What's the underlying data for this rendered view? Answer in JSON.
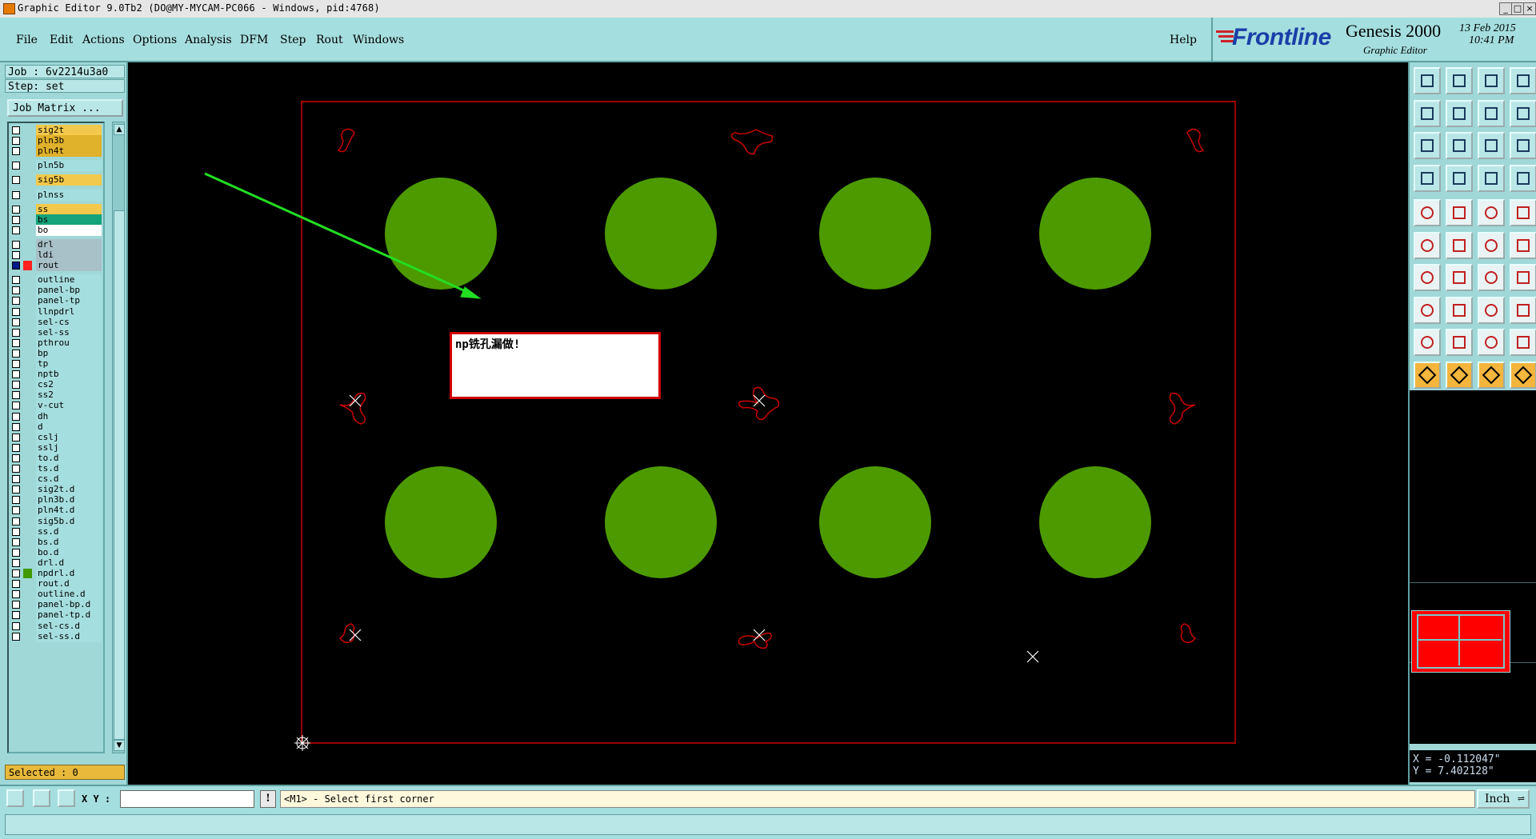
{
  "titlebar": {
    "title": "Graphic Editor 9.0Tb2 (DO@MY-MYCAM-PC066 - Windows, pid:4768)",
    "min_icon": "minimize-icon",
    "max_icon": "maximize-icon",
    "close_icon": "close-icon"
  },
  "menu": {
    "file": "File",
    "edit": "Edit",
    "actions": "Actions",
    "options": "Options",
    "analysis": "Analysis",
    "dfm": "DFM",
    "step": "Step",
    "rout": "Rout",
    "windows": "Windows",
    "help": "Help"
  },
  "brand": {
    "logo": "Frontline",
    "product": "Genesis 2000",
    "subtitle": "Graphic Editor",
    "date": "13 Feb 2015",
    "time": "10:41 PM"
  },
  "left": {
    "job": "Job : 6v2214u3a0",
    "step": "Step: set",
    "job_matrix": "Job Matrix ...",
    "selected": "Selected : 0",
    "layers": [
      {
        "name": "sig2t",
        "color": "#f2c94c"
      },
      {
        "name": "pln3b",
        "color": "#e0b12a"
      },
      {
        "name": "pln4t",
        "color": "#e0b12a"
      },
      {
        "name": "pln5b",
        "color": "#a5dede"
      },
      {
        "name": "sig5b",
        "color": "#f2c94c"
      },
      {
        "name": "plnss",
        "color": "#a5dede"
      },
      {
        "name": "ss",
        "color": "#f2c94c"
      },
      {
        "name": "bs",
        "color": "#14a37a"
      },
      {
        "name": "bo",
        "color": "#ffffff"
      },
      {
        "name": "drl",
        "color": "#a8c0c8"
      },
      {
        "name": "ldi",
        "color": "#a8c0c8"
      },
      {
        "name": "rout",
        "color": "#a8c0c8"
      },
      {
        "name": "outline",
        "color": "#a5dede"
      },
      {
        "name": "panel-bp",
        "color": "#a5dede"
      },
      {
        "name": "panel-tp",
        "color": "#a5dede"
      },
      {
        "name": "llnpdrl",
        "color": "#a5dede"
      },
      {
        "name": "sel-cs",
        "color": "#a5dede"
      },
      {
        "name": "sel-ss",
        "color": "#a5dede"
      },
      {
        "name": "pthrou",
        "color": "#a5dede"
      },
      {
        "name": "bp",
        "color": "#a5dede"
      },
      {
        "name": "tp",
        "color": "#a5dede"
      },
      {
        "name": "nptb",
        "color": "#a5dede"
      },
      {
        "name": "cs2",
        "color": "#a5dede"
      },
      {
        "name": "ss2",
        "color": "#a5dede"
      },
      {
        "name": "v-cut",
        "color": "#a5dede"
      },
      {
        "name": "dh",
        "color": "#a5dede"
      },
      {
        "name": "d",
        "color": "#a5dede"
      },
      {
        "name": "cslj",
        "color": "#a5dede"
      },
      {
        "name": "sslj",
        "color": "#a5dede"
      },
      {
        "name": "to.d",
        "color": "#a5dede"
      },
      {
        "name": "ts.d",
        "color": "#a5dede"
      },
      {
        "name": "cs.d",
        "color": "#a5dede"
      },
      {
        "name": "sig2t.d",
        "color": "#a5dede"
      },
      {
        "name": "pln3b.d",
        "color": "#a5dede"
      },
      {
        "name": "pln4t.d",
        "color": "#a5dede"
      },
      {
        "name": "sig5b.d",
        "color": "#a5dede"
      },
      {
        "name": "ss.d",
        "color": "#a5dede"
      },
      {
        "name": "bs.d",
        "color": "#a5dede"
      },
      {
        "name": "bo.d",
        "color": "#a5dede"
      },
      {
        "name": "drl.d",
        "color": "#a5dede"
      },
      {
        "name": "npdrl.d",
        "color": "#a5dede"
      },
      {
        "name": "rout.d",
        "color": "#a5dede"
      },
      {
        "name": "outline.d",
        "color": "#a5dede"
      },
      {
        "name": "panel-bp.d",
        "color": "#a5dede"
      },
      {
        "name": "panel-tp.d",
        "color": "#a5dede"
      },
      {
        "name": "sel-cs.d",
        "color": "#a5dede"
      },
      {
        "name": "sel-ss.d",
        "color": "#a5dede"
      }
    ]
  },
  "canvas": {
    "annotation": "np铣孔漏做!",
    "pad_color": "#4c9a00",
    "outline_color": "#cc0000",
    "arrow_color": "#22dd22"
  },
  "coords": {
    "x": "X = -0.112047\"",
    "y": "Y = 7.402128\""
  },
  "status": {
    "xy_label": "X Y :",
    "xy_value": "",
    "message": "<M1> - Select first corner",
    "units": "Inch"
  }
}
